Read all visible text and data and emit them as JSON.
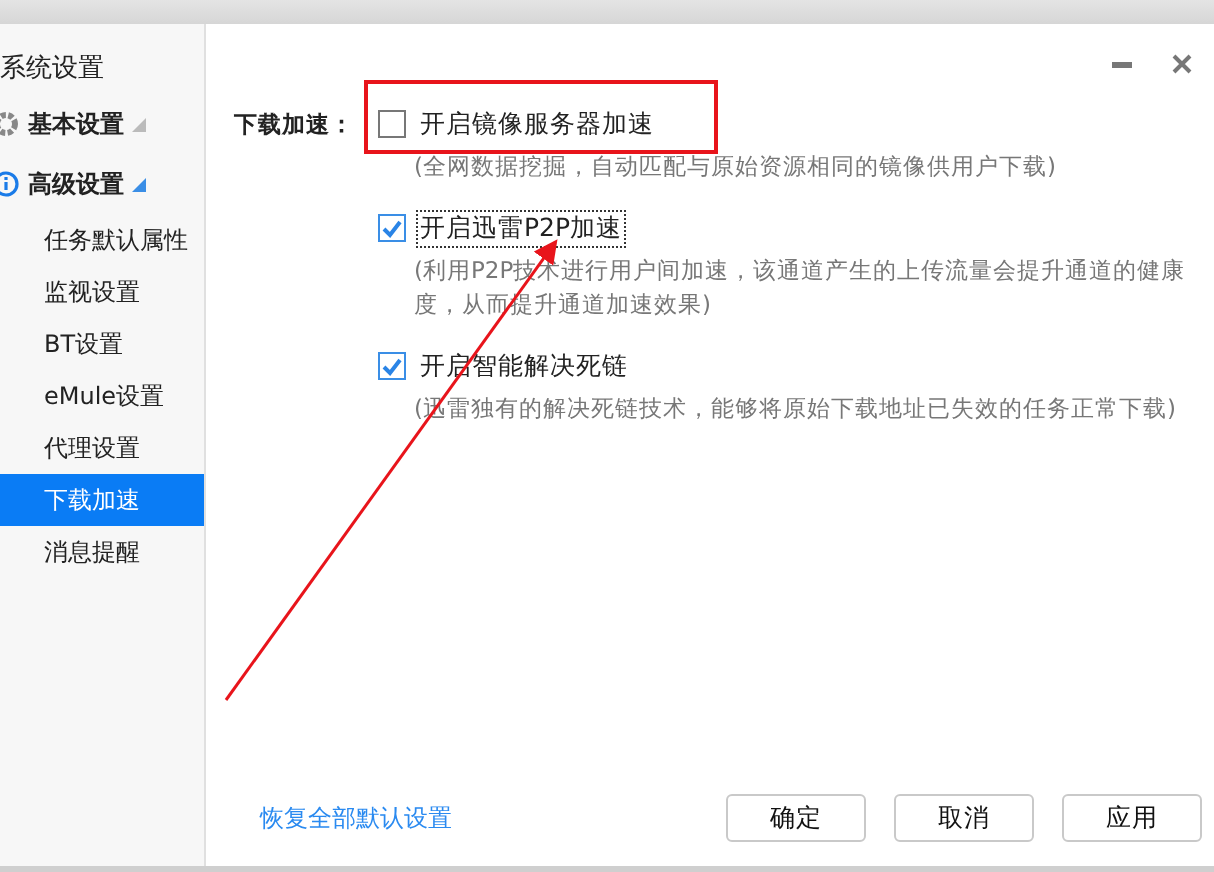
{
  "sidebar": {
    "title": "系统设置",
    "groups": [
      {
        "label": "基本设置",
        "expanded": false
      },
      {
        "label": "高级设置",
        "expanded": true,
        "children": [
          {
            "label": "任务默认属性",
            "selected": false
          },
          {
            "label": "监视设置",
            "selected": false
          },
          {
            "label": "BT设置",
            "selected": false
          },
          {
            "label": "eMule设置",
            "selected": false
          },
          {
            "label": "代理设置",
            "selected": false
          },
          {
            "label": "下载加速",
            "selected": true
          },
          {
            "label": "消息提醒",
            "selected": false
          }
        ]
      }
    ]
  },
  "window_controls": [
    {
      "kind": "minimize"
    },
    {
      "kind": "close"
    }
  ],
  "section": {
    "label": "下载加速：",
    "options": [
      {
        "label": "开启镜像服务器加速",
        "checked": false,
        "focused": false,
        "description": "(全网数据挖掘，自动匹配与原始资源相同的镜像供用户下载)"
      },
      {
        "label": "开启迅雷P2P加速",
        "checked": true,
        "focused": true,
        "description": "(利用P2P技术进行用户间加速，该通道产生的上传流量会提升通道的健康度，从而提升通道加速效果)"
      },
      {
        "label": "开启智能解决死链",
        "checked": true,
        "focused": false,
        "description": "(迅雷独有的解决死链技术，能够将原始下载地址已失效的任务正常下载)"
      }
    ]
  },
  "footer": {
    "link": "恢复全部默认设置",
    "buttons": [
      "确定",
      "取消",
      "应用"
    ]
  }
}
